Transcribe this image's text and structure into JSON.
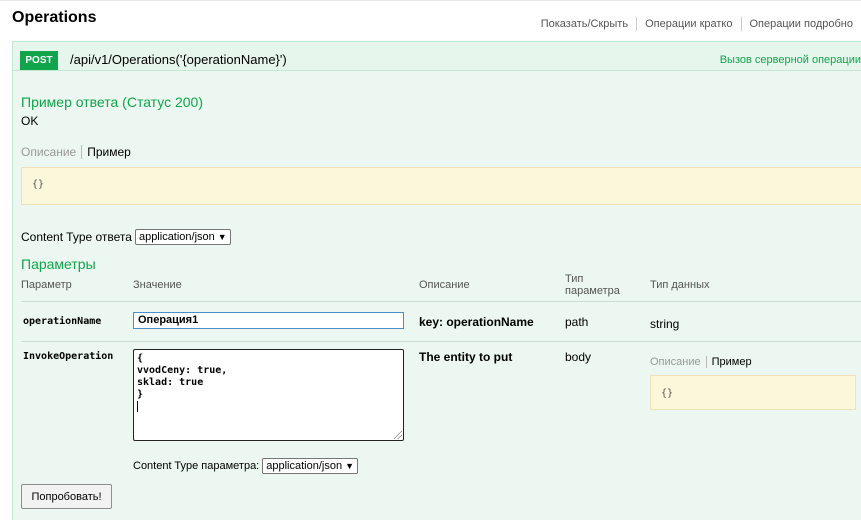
{
  "header": {
    "title": "Operations",
    "links": [
      "Показать/Скрыть",
      "Операции кратко",
      "Операции подробно"
    ]
  },
  "operation": {
    "method": "POST",
    "path": "/api/v1/Operations('{operationName}')",
    "summary": "Вызов серверной операции"
  },
  "response": {
    "title": "Пример ответа (Статус 200)",
    "status_text": "OK",
    "tabs": {
      "description": "Описание",
      "example": "Пример"
    },
    "example_code": "{}",
    "content_type_label": "Content Type ответа",
    "content_type_value": "application/json"
  },
  "params": {
    "title": "Параметры",
    "headers": {
      "param": "Параметр",
      "value": "Значение",
      "description": "Описание",
      "type": "Тип параметра",
      "data_type": "Тип данных"
    },
    "rows": [
      {
        "name": "operationName",
        "value": "Операция1",
        "description": "key: operationName",
        "type": "path",
        "data_type": "string"
      },
      {
        "name": "InvokeOperation",
        "value": "{\nvvodCeny: true,\nsklad: true\n}",
        "description": "The entity to put",
        "type": "body",
        "data_tabs": {
          "description": "Описание",
          "example": "Пример"
        },
        "data_example_code": "{}"
      }
    ],
    "param_content_type_label": "Content Type параметра:",
    "param_content_type_value": "application/json"
  },
  "try_button": "Попробовать!",
  "colors": {
    "accent_green": "#10a54a",
    "panel_bg": "#ebf7f0",
    "code_bg": "#fcf6db"
  }
}
